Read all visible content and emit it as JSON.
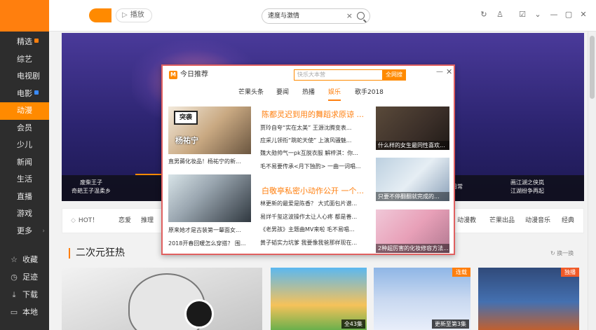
{
  "sidebar": {
    "nav": [
      {
        "label": "精选",
        "badge": "orange"
      },
      {
        "label": "综艺"
      },
      {
        "label": "电视剧"
      },
      {
        "label": "电影",
        "badge": "blue"
      },
      {
        "label": "动漫",
        "active": true
      },
      {
        "label": "会员"
      },
      {
        "label": "少儿"
      },
      {
        "label": "新闻"
      },
      {
        "label": "生活"
      },
      {
        "label": "直播"
      },
      {
        "label": "游戏"
      },
      {
        "label": "更多"
      }
    ],
    "bottom": [
      {
        "label": "收藏",
        "icon": "star-icon",
        "glyph": "☆"
      },
      {
        "label": "足迹",
        "icon": "clock-icon",
        "glyph": "◷"
      },
      {
        "label": "下载",
        "icon": "download-icon",
        "glyph": "⤓"
      },
      {
        "label": "本地",
        "icon": "folder-icon",
        "glyph": "▭"
      }
    ]
  },
  "topbar": {
    "play_label": "播放",
    "search_value": "速度与激情",
    "search_clear": "×"
  },
  "banner": {
    "captions": [
      "废柴王子\n奇葩王子温柔乡",
      "",
      "",
      "",
      "",
      "灵异日常",
      "画江湖之侠岚\n江湖纷争再起"
    ]
  },
  "tagbar": {
    "hot": "HOT！",
    "tags": [
      "恋爱",
      "推理",
      "动漫教",
      "芒果出品",
      "动漫音乐",
      "经典"
    ]
  },
  "section": {
    "title": "二次元狂热",
    "swap": "换一换"
  },
  "thumbs": {
    "t2_badge": "全43集",
    "t3_corner": "连载",
    "t3_badge": "更新至第3集",
    "t4_corner": "独播"
  },
  "popup": {
    "title": "今日推荐",
    "search_placeholder": "快乐大本营",
    "search_button": "全网搜",
    "tabs": [
      "芒果头条",
      "要闻",
      "热播",
      "娱乐",
      "歌手2018"
    ],
    "active_tab": 3,
    "left_captions": [
      "直男薅化妆品！杨祐宁的新...",
      "原来她才是古装第一颦面女...",
      "2018开春回暖怎么穿搭？ 围..."
    ],
    "img1_badge": "突袭",
    "img1_text": "杨祐宁",
    "headline1": "陈都灵迟到用的舞蹈求原谅 ...",
    "lines1": [
      "贾玲自夸“实在太美” 王源沈腾变表...",
      "应采儿领衔“跳蛇天使” 上演风骚魅...",
      "魏大勋帅气一pk互脱衣服 解梓淇：你...",
      "毛不易要传承<月下独酌> 一曲一词唱..."
    ],
    "headline2": "白敬亭私密小动作公开 一个...",
    "lines2": [
      "林更新的最爱是陈香？ 大式面包片谱...",
      "易烊千玺这波操作太让人心疼 都是善...",
      "《老男孩》主题曲MV来啦 毛不易唱...",
      "黄子韬实力坑爹 我要像我爸那样现在..."
    ],
    "right_captions": [
      "什么样的女生最同性喜欢...",
      "只要不停翻翻就完成的...",
      "2种超厉害的化妆修容方法..."
    ]
  }
}
